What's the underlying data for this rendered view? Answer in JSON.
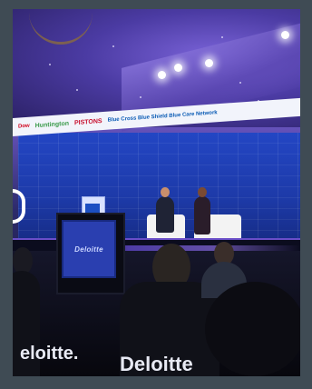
{
  "photo": {
    "banner": {
      "sponsors": [
        "Dow",
        "Huntington",
        "PISTONS",
        "Blue Cross Blue Shield Blue Care Network"
      ]
    },
    "monitor_text": "Deloitte",
    "shirt_text_left": "eloitte.",
    "shirt_text_right": "Deloitte"
  },
  "colors": {
    "screen_blue": "#1d3aa8",
    "ceiling_purple": "#5a3fa8",
    "stage_glow": "#7b5cff",
    "banner_white": "#f2f4fb"
  }
}
